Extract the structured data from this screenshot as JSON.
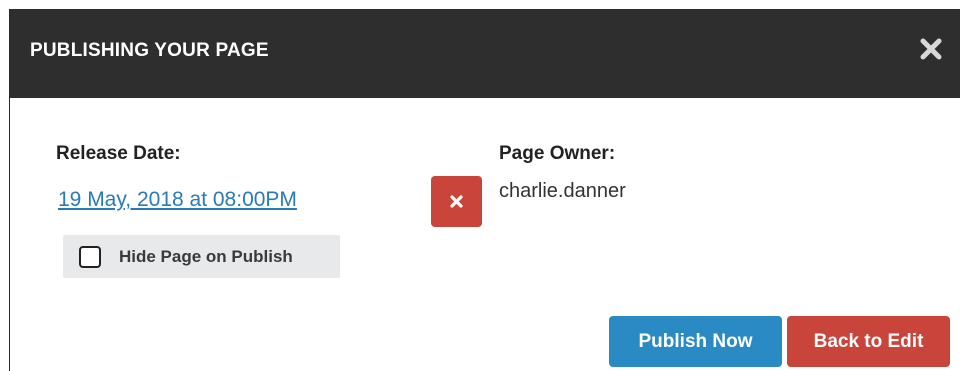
{
  "modal": {
    "title": "PUBLISHING YOUR PAGE",
    "close_icon": "close-icon"
  },
  "release": {
    "label": "Release Date:",
    "date_link": "19 May, 2018 at 08:00PM",
    "clear_icon": "close-icon"
  },
  "hide_on_publish": {
    "label": "Hide Page on Publish",
    "checked": false
  },
  "owner": {
    "label": "Page Owner:",
    "value": "charlie.danner"
  },
  "actions": {
    "publish_label": "Publish Now",
    "back_label": "Back to Edit"
  },
  "colors": {
    "header_bg": "#2e2e2e",
    "link": "#2a7ab8",
    "primary": "#2a8ac4",
    "danger": "#c9443a",
    "checkbox_area": "#e8e9eb"
  }
}
